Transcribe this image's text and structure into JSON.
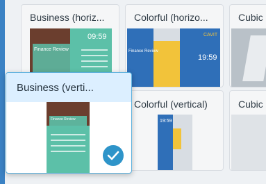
{
  "templates": [
    {
      "title": "Business (horiz...",
      "time": "09:59",
      "thumb_heading": "Finance Review",
      "selected": false
    },
    {
      "title": "Colorful (horizo...",
      "time": "19:59",
      "thumb_heading": "Finance Review",
      "brand": "CAVIT",
      "selected": false
    },
    {
      "title": "Cubic",
      "selected": false
    },
    {
      "title": "Business (verti...",
      "thumb_heading": "Finance Review",
      "selected": true
    },
    {
      "title": "Colorful (vertical)",
      "time": "19:59",
      "selected": false
    },
    {
      "title": "Cubic",
      "selected": false
    }
  ],
  "colors": {
    "accent": "#2e94c9",
    "selected_header": "#dcefff",
    "teal": "#5cc0a8",
    "blue": "#2f6fb8",
    "yellow": "#f2c33a"
  },
  "icons": {
    "selected_check": "checkmark-icon"
  }
}
